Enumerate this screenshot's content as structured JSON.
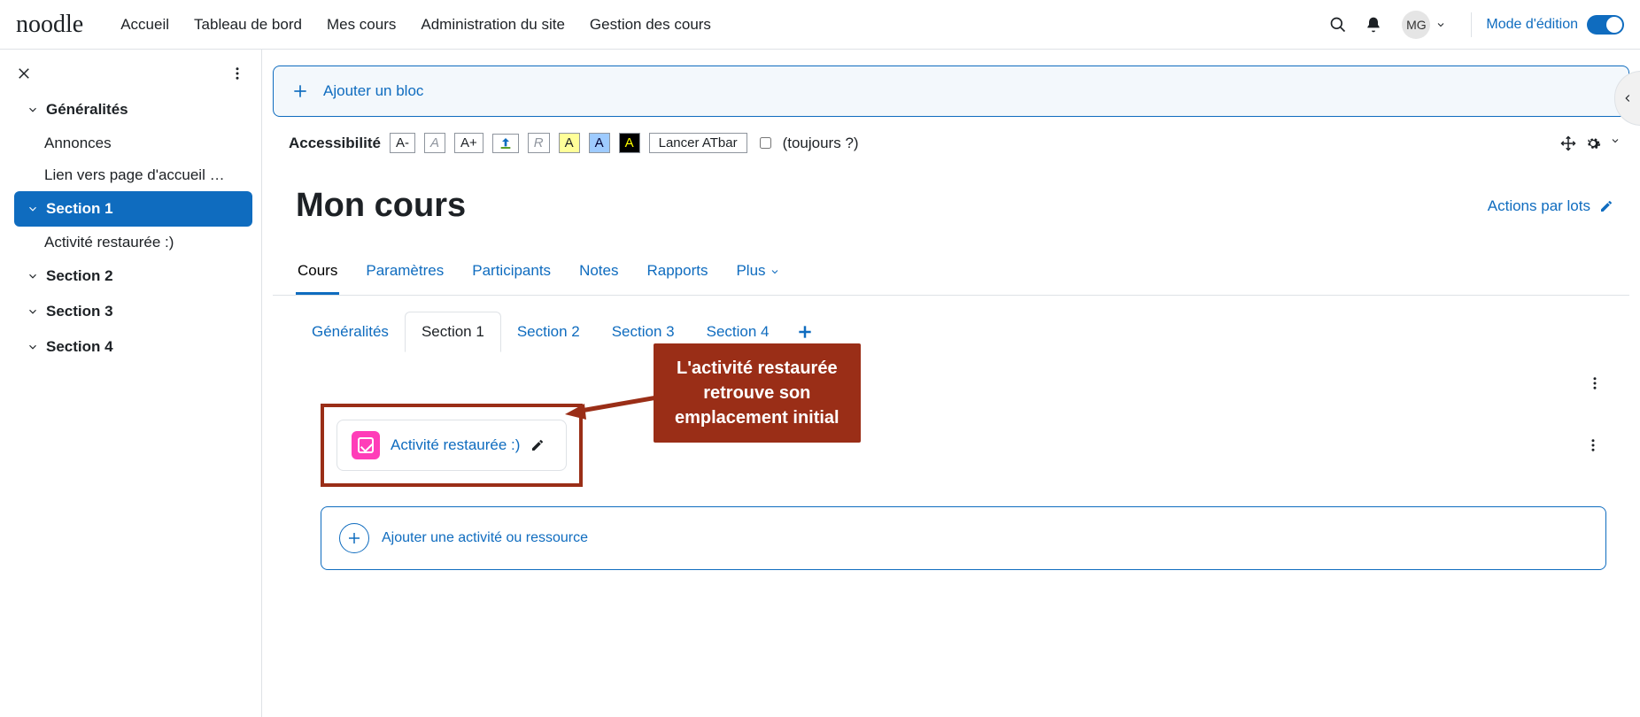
{
  "logo": "noodle",
  "nav": {
    "accueil": "Accueil",
    "tableau": "Tableau de bord",
    "mescours": "Mes cours",
    "admin": "Administration du site",
    "gestion": "Gestion des cours"
  },
  "user_initials": "MG",
  "editmode_label": "Mode d'édition",
  "sidebar": {
    "sections": [
      {
        "label": "Généralités",
        "items": [
          "Annonces",
          "Lien vers page d'accueil Moo…"
        ],
        "active": false
      },
      {
        "label": "Section 1",
        "items": [
          "Activité restaurée :)"
        ],
        "active": true
      },
      {
        "label": "Section 2",
        "items": [],
        "active": false
      },
      {
        "label": "Section 3",
        "items": [],
        "active": false
      },
      {
        "label": "Section 4",
        "items": [],
        "active": false
      }
    ]
  },
  "addblock": "Ajouter un bloc",
  "accessibility": {
    "label": "Accessibilité",
    "aminus": "A-",
    "a": "A",
    "aplus": "A+",
    "r": "R",
    "yA": "A",
    "bA": "A",
    "kA": "A",
    "atbar": "Lancer ATbar",
    "always": "(toujours ?)"
  },
  "course_title": "Mon cours",
  "bulkactions": "Actions par lots",
  "course_tabs": {
    "cours": "Cours",
    "parametres": "Paramètres",
    "participants": "Participants",
    "notes": "Notes",
    "rapports": "Rapports",
    "plus": "Plus"
  },
  "section_tabs": {
    "generalites": "Généralités",
    "s1": "Section 1",
    "s2": "Section 2",
    "s3": "Section 3",
    "s4": "Section 4"
  },
  "activity_name": "Activité restaurée :)",
  "add_activity": "Ajouter une activité ou ressource",
  "annotation": {
    "l1": "L'activité restaurée",
    "l2": "retrouve son",
    "l3": "emplacement initial"
  }
}
